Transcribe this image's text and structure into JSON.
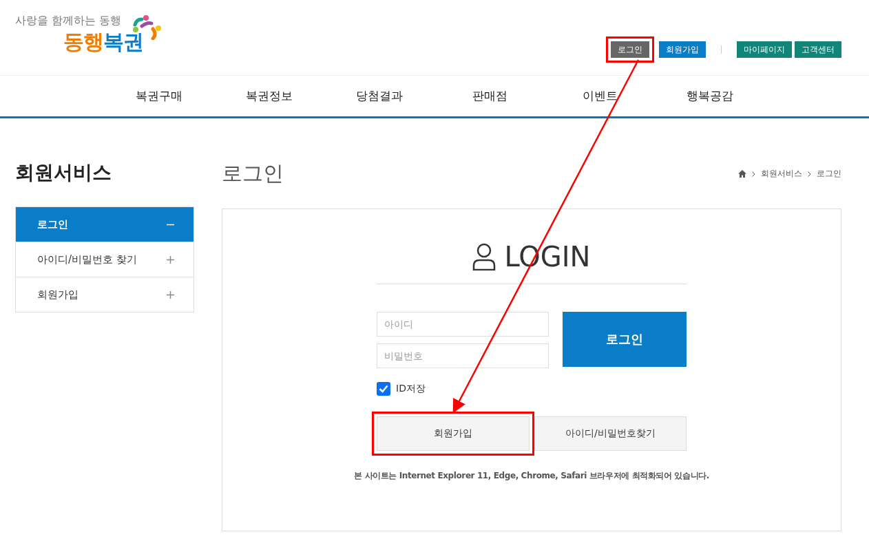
{
  "header": {
    "slogan": "사랑을 함께하는 동행",
    "logo": [
      {
        "text": "동행",
        "color": "#f07d00"
      },
      {
        "text": "복권",
        "color": "#0a7dc8"
      }
    ],
    "util_links": [
      {
        "label": "로그인",
        "kind": "dark",
        "highlighted": true
      },
      {
        "label": "회원가입",
        "kind": "blue",
        "highlighted": false
      },
      {
        "label": "마이페이지",
        "kind": "green",
        "highlighted": false
      },
      {
        "label": "고객센터",
        "kind": "green",
        "highlighted": false
      }
    ]
  },
  "nav": [
    "복권구매",
    "복권정보",
    "당첨결과",
    "판매점",
    "이벤트",
    "행복공감"
  ],
  "sidebar": {
    "title": "회원서비스",
    "items": [
      {
        "label": "로그인",
        "selected": true,
        "expanded": true
      },
      {
        "label": "아이디/비밀번호 찾기",
        "selected": false,
        "expanded": false
      },
      {
        "label": "회원가입",
        "selected": false,
        "expanded": false
      }
    ]
  },
  "main": {
    "title": "로그인",
    "breadcrumb": [
      "회원서비스",
      "로그인"
    ],
    "login": {
      "heading": "LOGIN",
      "id_placeholder": "아이디",
      "password_placeholder": "비밀번호",
      "submit": "로그인",
      "remember": {
        "label": "ID저장",
        "checked": true
      },
      "buttons": [
        {
          "label": "회원가입",
          "highlighted": true
        },
        {
          "label": "아이디/비밀번호찾기",
          "highlighted": false
        }
      ],
      "notice": "본 사이트는 Internet Explorer 11, Edge, Chrome, Safari 브라우저에 최적화되어 있습니다."
    }
  }
}
